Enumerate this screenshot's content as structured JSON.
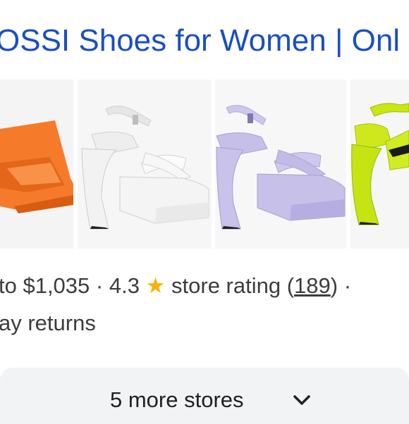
{
  "result": {
    "title": "OSSI Shoes for Women | Onl"
  },
  "thumbnails": [
    {
      "label": "orange platform sandal",
      "color": "#f57b2a"
    },
    {
      "label": "white platform sandal",
      "color": "#f0f0f0"
    },
    {
      "label": "lilac platform sandal",
      "color": "#c3bce6"
    },
    {
      "label": "lime platform sandal",
      "color": "#c9e615"
    }
  ],
  "meta": {
    "price": "to $1,035",
    "sep1": " · ",
    "rating": "4.3",
    "star": "★",
    "rating_label": "store rating",
    "paren_open": "(",
    "reviews": "189",
    "paren_close": ")",
    "sep2": " ·",
    "returns": "ay returns"
  },
  "more": {
    "label": "5 more stores"
  },
  "colors": {
    "link": "#1a4fc0",
    "star": "#f6b400",
    "bar": "#f1f3f4"
  }
}
